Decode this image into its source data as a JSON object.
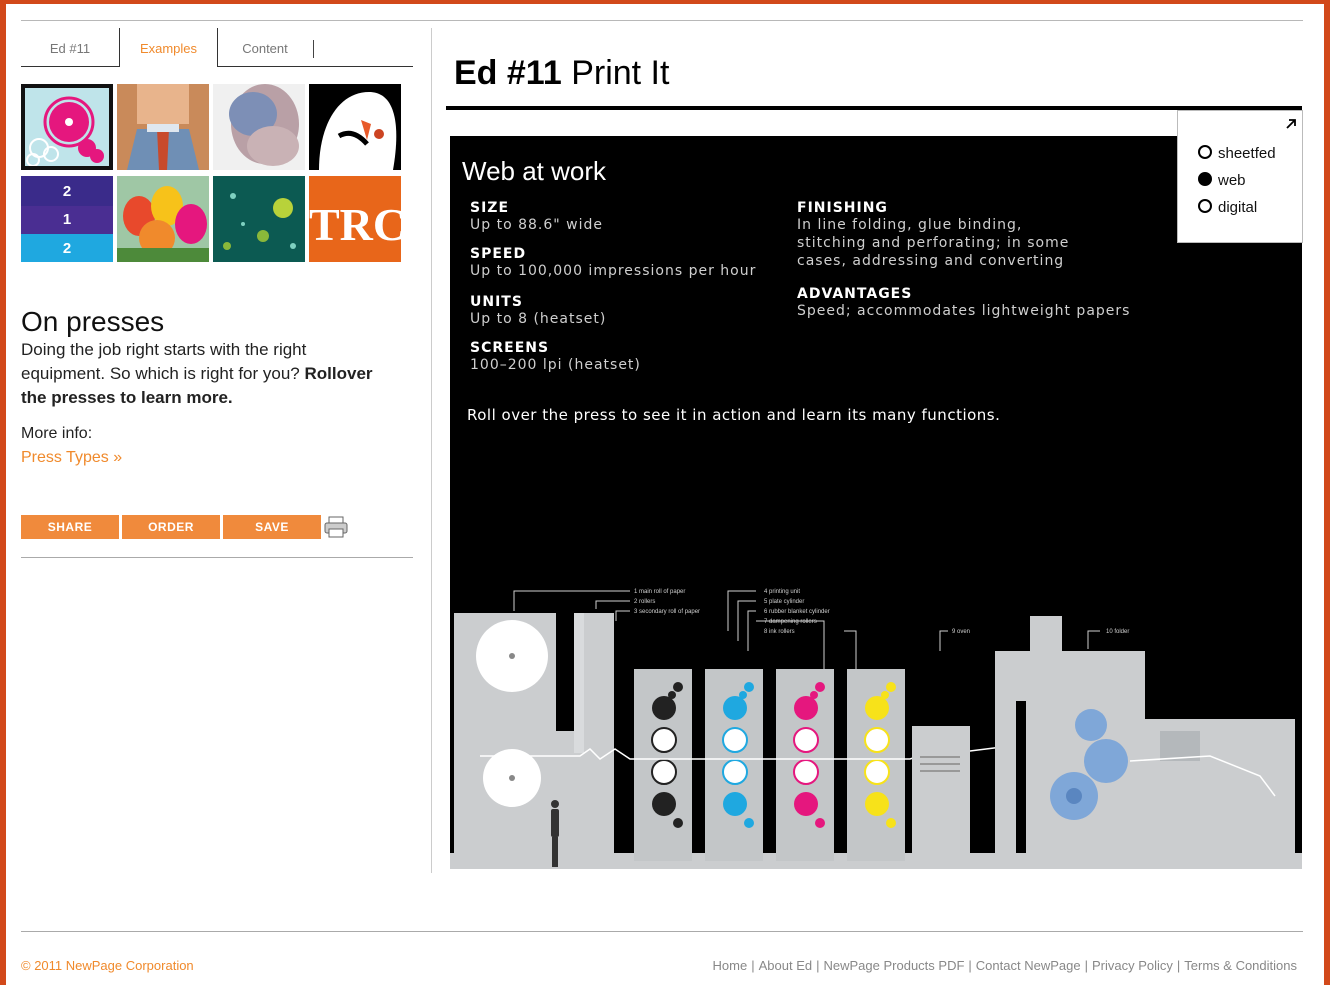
{
  "tabs": [
    {
      "label": "Ed #11"
    },
    {
      "label": "Examples"
    },
    {
      "label": "Content"
    }
  ],
  "left": {
    "heading": "On presses",
    "intro": "Doing the job right starts with the right equipment. So which is right for you?",
    "intro_bold": "Rollover the presses to learn more.",
    "more_info": "More info:",
    "press_types_link": "Press Types »"
  },
  "thumbs": {
    "calendar_numbers": [
      "2",
      "1",
      "2"
    ],
    "orange_text": "TRC"
  },
  "actions": {
    "share": "SHARE",
    "order": "ORDER",
    "save": "SAVE"
  },
  "main": {
    "title_bold": "Ed #11",
    "title_rest": "Print It",
    "panel_heading": "Web at work",
    "specs_left": [
      {
        "key": "SIZE",
        "value": "Up to 88.6\" wide"
      },
      {
        "key": "SPEED",
        "value": "Up to 100,000 impressions per hour"
      },
      {
        "key": "UNITS",
        "value": "Up to 8 (heatset)"
      },
      {
        "key": "SCREENS",
        "value": "100–200 lpi (heatset)"
      }
    ],
    "specs_right": [
      {
        "key": "FINISHING",
        "lines": [
          "In line folding, glue binding,",
          "stitching and perforating; in some",
          "cases, addressing and converting"
        ]
      },
      {
        "key": "ADVANTAGES",
        "lines": [
          "Speed; accommodates lightweight papers"
        ]
      }
    ],
    "rollover_text": "Roll over the press to see it in action and learn its many functions.",
    "diagram_labels": {
      "group1": [
        "1  main roll of paper",
        "2  rollers",
        "3  secondary roll of paper"
      ],
      "group2": [
        "4  printing unit",
        "5  plate cylinder",
        "6  rubber blanket cylinder",
        "7  dampening rollers",
        "8  ink rollers"
      ],
      "oven": "9  oven",
      "folder": "10  folder"
    }
  },
  "press_selector": {
    "options": [
      {
        "label": "sheetfed",
        "selected": false
      },
      {
        "label": "web",
        "selected": true
      },
      {
        "label": "digital",
        "selected": false
      }
    ]
  },
  "footer": {
    "copyright": "© 2011 NewPage Corporation",
    "links": [
      "Home",
      "About Ed",
      "NewPage Products PDF",
      "Contact NewPage",
      "Privacy Policy",
      "Terms & Conditions"
    ]
  },
  "colors": {
    "accent": "#f08a2c",
    "frame": "#d2491a",
    "cyan": "#1fa8e0",
    "magenta": "#e5177e",
    "yellow": "#f7e21a"
  }
}
